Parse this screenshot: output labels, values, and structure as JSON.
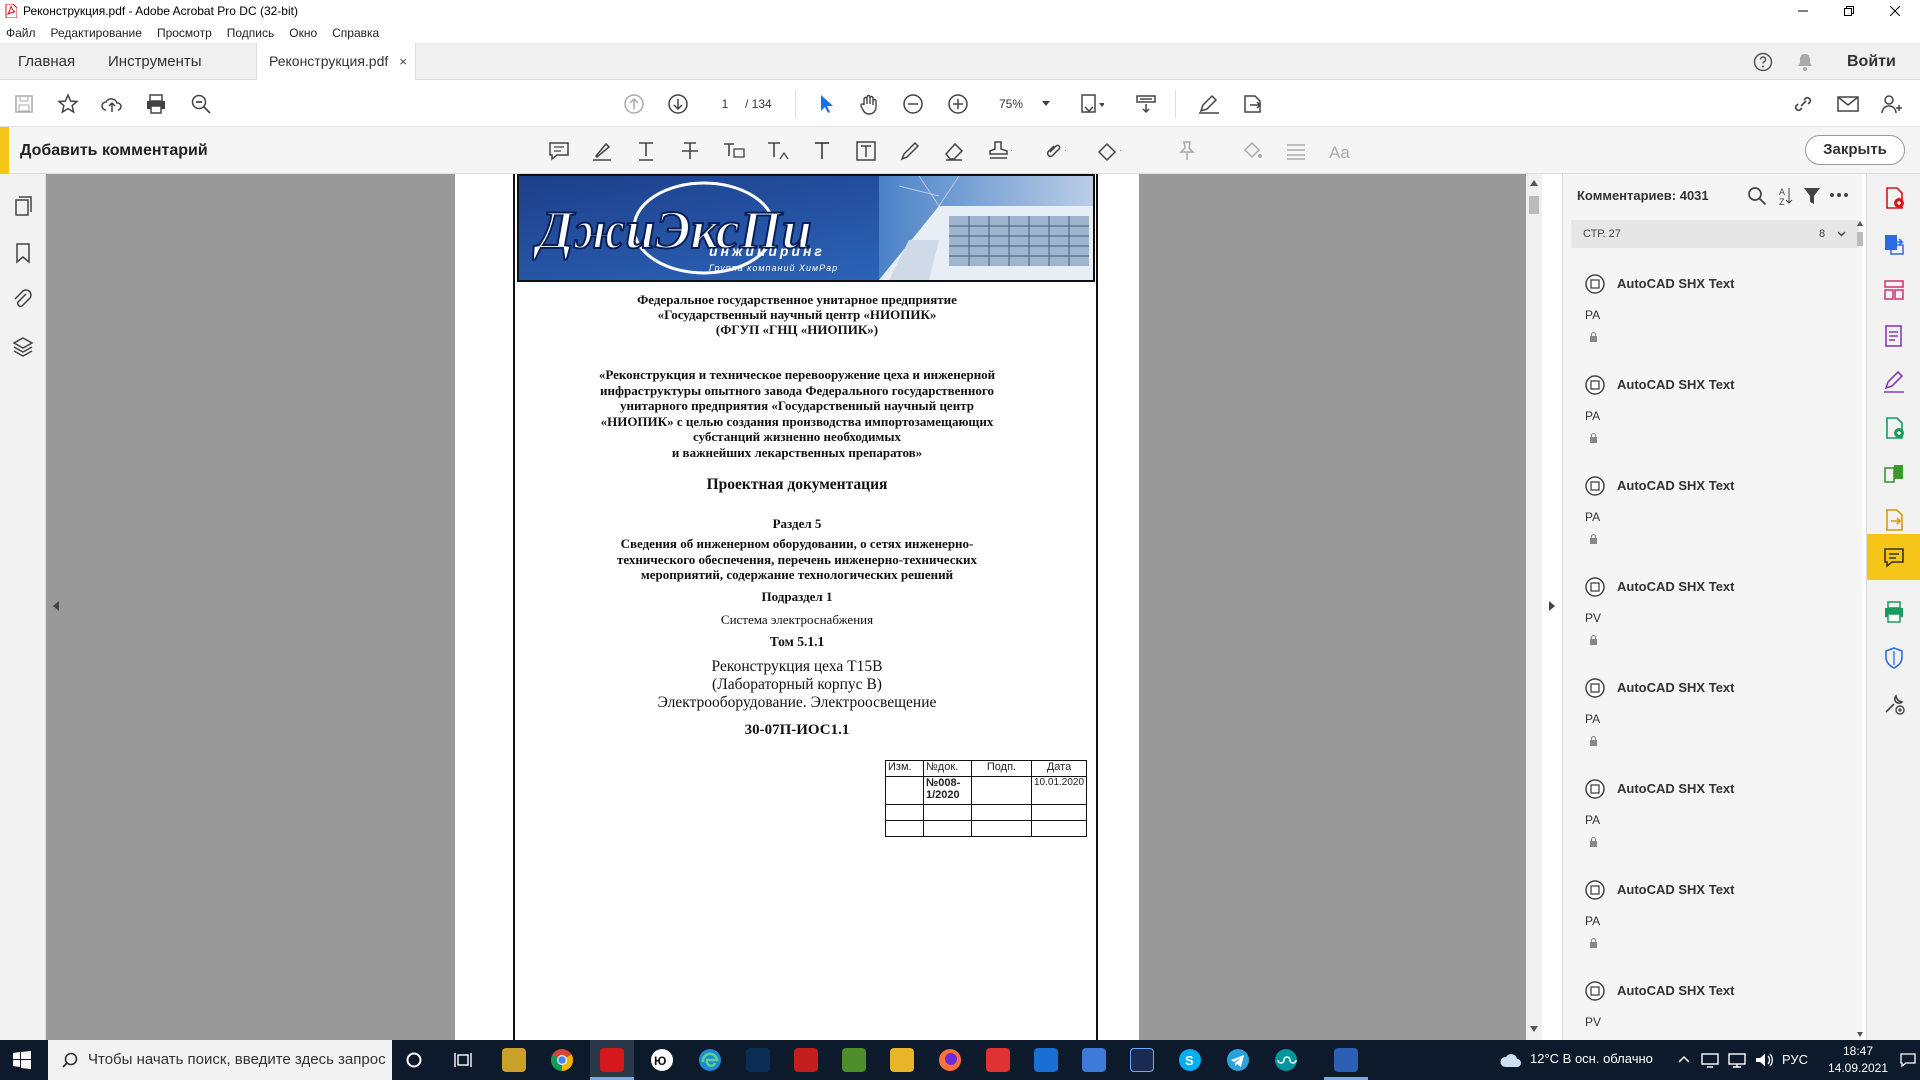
{
  "window": {
    "title": "Реконструкция.pdf - Adobe Acrobat Pro DC (32-bit)"
  },
  "menu": [
    "Файл",
    "Редактирование",
    "Просмотр",
    "Подпись",
    "Окно",
    "Справка"
  ],
  "tabs": {
    "home": "Главная",
    "tools": "Инструменты",
    "document": "Реконструкция.pdf",
    "close": "×",
    "sign_in": "Войти"
  },
  "toolbar": {
    "page_current": "1",
    "page_total": "/ 134",
    "zoom": "75%"
  },
  "comment_bar": {
    "label": "Добавить комментарий",
    "close": "Закрыть"
  },
  "document": {
    "org_line1": "Федеральное государственное унитарное предприятие",
    "org_line2": "«Государственный научный центр «НИОПИК»",
    "org_line3": "(ФГУП «ГНЦ «НИОПИК»)",
    "project_lines": [
      "«Реконструкция и техническое перевооружение цеха и инженерной",
      "инфраструктуры опытного завода Федерального государственного",
      "унитарного предприятия «Государственный научный центр",
      "«НИОПИК» с целью создания производства импортозамещающих",
      "субстанций жизненно необходимых",
      "и важнейших лекарственных препаратов»"
    ],
    "doc_type": "Проектная документация",
    "section": "Раздел 5",
    "section_lines": [
      "Сведения об инженерном оборудовании, о сетях инженерно-",
      "технического обеспечения, перечень инженерно-технических",
      "мероприятий, содержание технологических решений"
    ],
    "subsection": "Подраздел 1",
    "subsection_name": "Система электроснабжения",
    "volume": "Том 5.1.1",
    "title_lines": [
      "Реконструкция цеха Т15В",
      "(Лабораторный корпус В)",
      "Электрооборудование. Электроосвещение"
    ],
    "code": "30-07П-ИОС1.1",
    "table": {
      "headers": [
        "Изм.",
        "№док.",
        "Подп.",
        "Дата"
      ],
      "row1": [
        "",
        "№008-1/2020",
        "",
        "10.01.2020"
      ]
    }
  },
  "comments": {
    "header": "Комментариев: 4031",
    "group_label": "СТР. 27",
    "group_count": "8",
    "items": [
      {
        "name": "AutoCAD SHX Text",
        "text": "PA"
      },
      {
        "name": "AutoCAD SHX Text",
        "text": "PA"
      },
      {
        "name": "AutoCAD SHX Text",
        "text": "PA"
      },
      {
        "name": "AutoCAD SHX Text",
        "text": "PV"
      },
      {
        "name": "AutoCAD SHX Text",
        "text": "PA"
      },
      {
        "name": "AutoCAD SHX Text",
        "text": "PA"
      },
      {
        "name": "AutoCAD SHX Text",
        "text": "PA"
      },
      {
        "name": "AutoCAD SHX Text",
        "text": "PV"
      }
    ]
  },
  "taskbar": {
    "search_placeholder": "Чтобы начать поиск, введите здесь запрос",
    "weather": "12°C  В осн. облачно",
    "lang": "РУС",
    "time": "18:47",
    "date": "14.09.2021"
  },
  "colors": {
    "accent": "#f5c518",
    "acrobat_red": "#d4181c",
    "link_blue": "#1473e6",
    "taskbar": "#0d1a2b"
  }
}
